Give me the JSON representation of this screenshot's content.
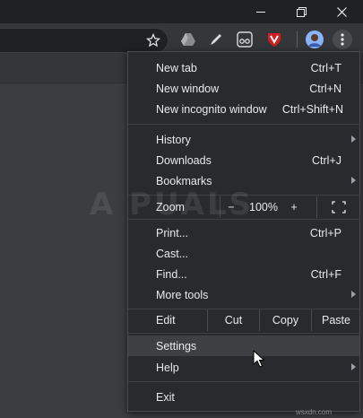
{
  "window": {
    "controls": [
      "minimize",
      "maximize",
      "close"
    ]
  },
  "toolbar": {
    "icons": [
      "star-icon",
      "drive-icon",
      "pen-icon",
      "glasses-icon",
      "shield-extension-icon",
      "profile-avatar",
      "menu-kebab-icon"
    ]
  },
  "menu": {
    "new_tab": {
      "label": "New tab",
      "shortcut": "Ctrl+T"
    },
    "new_window": {
      "label": "New window",
      "shortcut": "Ctrl+N"
    },
    "new_incognito": {
      "label": "New incognito window",
      "shortcut": "Ctrl+Shift+N"
    },
    "history": {
      "label": "History"
    },
    "downloads": {
      "label": "Downloads",
      "shortcut": "Ctrl+J"
    },
    "bookmarks": {
      "label": "Bookmarks"
    },
    "zoom": {
      "label": "Zoom",
      "minus": "−",
      "value": "100%",
      "plus": "+"
    },
    "print": {
      "label": "Print...",
      "shortcut": "Ctrl+P"
    },
    "cast": {
      "label": "Cast..."
    },
    "find": {
      "label": "Find...",
      "shortcut": "Ctrl+F"
    },
    "more_tools": {
      "label": "More tools"
    },
    "edit": {
      "label": "Edit",
      "cut": "Cut",
      "copy": "Copy",
      "paste": "Paste"
    },
    "settings": {
      "label": "Settings"
    },
    "help": {
      "label": "Help"
    },
    "exit": {
      "label": "Exit"
    }
  },
  "watermark": "A PUALS",
  "credit": "wsxdn.com",
  "colors": {
    "menu_bg": "#292a2d",
    "highlight": "#3f4043",
    "text": "#e8eaed",
    "titlebar": "#202124"
  }
}
